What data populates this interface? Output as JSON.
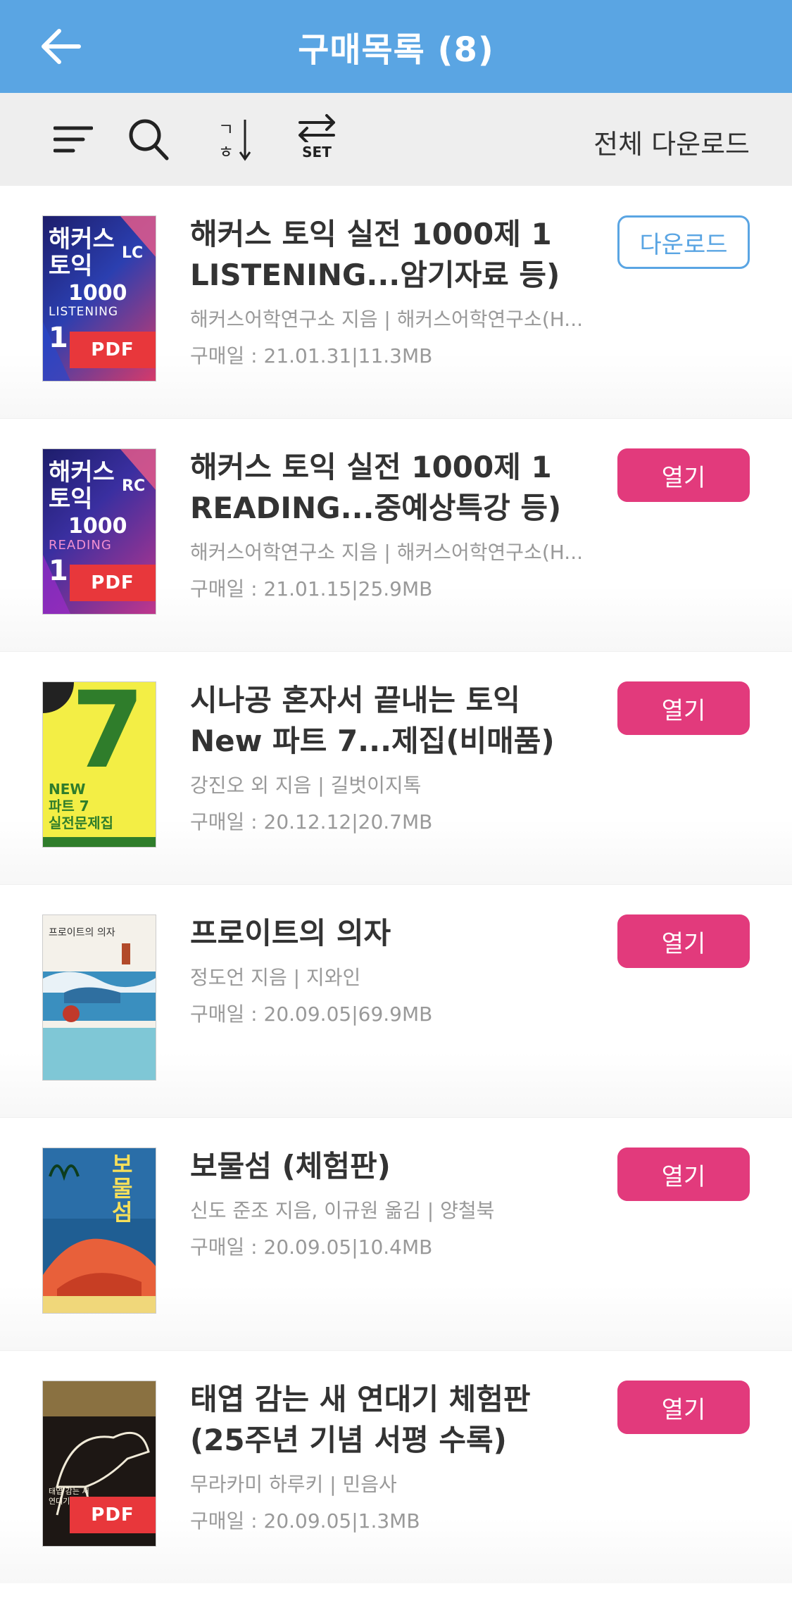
{
  "header": {
    "title": "구매목록 (8)"
  },
  "toolbar": {
    "download_all": "전체 다운로드",
    "set_label": "SET",
    "sort_top": "ㄱ",
    "sort_bottom": "ㅎ"
  },
  "items": [
    {
      "title": "해커스 토익 실전 1000제 1 LISTENING...암기자료 등)",
      "meta": "해커스어학연구소 지음 | 해커스어학연구소(H...",
      "date": "구매일 : 21.01.31|11.3MB",
      "action": "다운로드",
      "pdf": "PDF"
    },
    {
      "title": "해커스 토익 실전 1000제 1 READING...중예상특강 등)",
      "meta": "해커스어학연구소 지음 | 해커스어학연구소(H...",
      "date": "구매일 : 21.01.15|25.9MB",
      "action": "열기",
      "pdf": "PDF"
    },
    {
      "title": "시나공 혼자서 끝내는 토익 New 파트 7...제집(비매품)",
      "meta": "강진오 외 지음 | 길벗이지톡",
      "date": "구매일 : 20.12.12|20.7MB",
      "action": "열기"
    },
    {
      "title": "프로이트의 의자",
      "meta": "정도언 지음 | 지와인",
      "date": "구매일 : 20.09.05|69.9MB",
      "action": "열기"
    },
    {
      "title": "보물섬 (체험판)",
      "meta": "신도 준조 지음, 이규원 옮김 | 양철북",
      "date": "구매일 : 20.09.05|10.4MB",
      "action": "열기"
    },
    {
      "title": "태엽 감는 새 연대기 체험판 (25주년 기념 서평 수록)",
      "meta": "무라카미 하루키 | 민음사",
      "date": "구매일 : 20.09.05|1.3MB",
      "action": "열기",
      "pdf": "PDF"
    }
  ],
  "covers": [
    {
      "main": "해커스",
      "sub": "토익",
      "tag": "LC",
      "num": "1000",
      "word": "LISTENING",
      "vol": "1"
    },
    {
      "main": "해커스",
      "sub": "토익",
      "tag": "RC",
      "num": "1000",
      "word": "READING",
      "vol": "1"
    },
    {
      "big": "7",
      "line1": "NEW",
      "line2": "파트 7",
      "line3": "실전문제집"
    },
    {
      "title": "프로이트의 의자"
    },
    {
      "title": "보물섬"
    },
    {
      "title": "태엽 감는 새 연대기"
    }
  ],
  "colors": {
    "appbar": "#5aa5e3",
    "open_button": "#e23a7c",
    "download_button": "#5aa5e3",
    "pdf_badge": "#e8373b"
  }
}
